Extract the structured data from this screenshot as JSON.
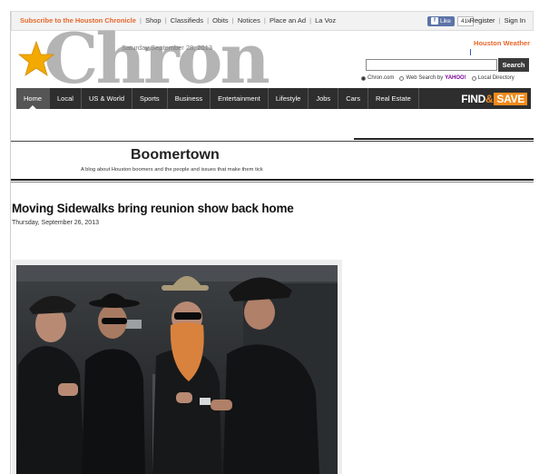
{
  "topbar": {
    "subscribe": "Subscribe to the Houston Chronicle",
    "links": [
      "Shop",
      "Classifieds",
      "Obits",
      "Notices",
      "Place an Ad",
      "La Voz"
    ],
    "fb_like": "Like",
    "fb_count": "41k",
    "register": "Register",
    "signin": "Sign In",
    "separator": "|"
  },
  "masthead": {
    "logo": "Chron",
    "date": "Saturday September 28, 2013",
    "weather_link": "Houston Weather",
    "search_button": "Search",
    "search_value": "",
    "search_options": [
      "Chron.com",
      "Web Search by",
      "Local Directory"
    ],
    "yahoo": "YAHOO!",
    "selected_option": "Chron.com"
  },
  "nav": {
    "items": [
      "Home",
      "Local",
      "US & World",
      "Sports",
      "Business",
      "Entertainment",
      "Lifestyle",
      "Jobs",
      "Cars",
      "Real Estate"
    ],
    "active": "Home",
    "promo_find": "FIND",
    "promo_amp": "&",
    "promo_save": "SAVE"
  },
  "blog": {
    "title": "Boomertown",
    "subtitle": "A blog about Houston boomers and the people and issues that make them tick"
  },
  "article": {
    "headline": "Moving Sidewalks bring reunion show back home",
    "date": "Thursday, September 26, 2013"
  },
  "colors": {
    "accent_orange": "#e8662b",
    "nav_bg": "#2e2e2e",
    "logo_gray": "#b4b4b4",
    "star_gold": "#f2a900"
  }
}
